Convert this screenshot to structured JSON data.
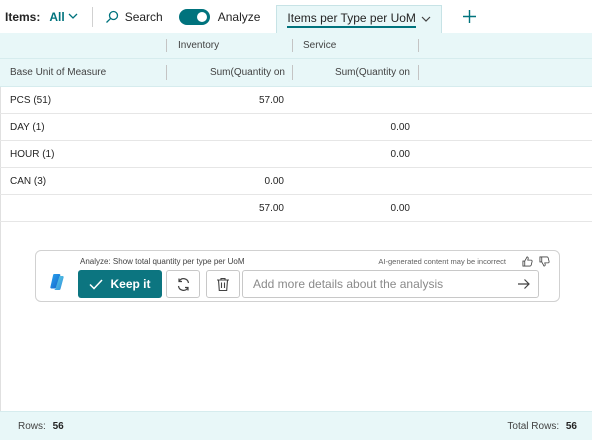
{
  "toolbar": {
    "items_label": "Items:",
    "filter_value": "All",
    "search_label": "Search",
    "analyze_label": "Analyze",
    "analyze_on": true,
    "active_tab": "Items per Type per UoM"
  },
  "grid": {
    "group_headers": [
      "Inventory",
      "Service"
    ],
    "columns": [
      "Base Unit of Measure",
      "Sum(Quantity on",
      "Sum(Quantity on"
    ],
    "rows": [
      [
        "PCS (51)",
        "57.00",
        ""
      ],
      [
        "DAY (1)",
        "",
        "0.00"
      ],
      [
        "HOUR (1)",
        "",
        "0.00"
      ],
      [
        "CAN (3)",
        "0.00",
        ""
      ]
    ],
    "totals": [
      "",
      "57.00",
      "0.00"
    ]
  },
  "copilot": {
    "title": "Analyze: Show total quantity per type per UoM",
    "disclaimer": "AI-generated content may be incorrect",
    "keep_label": "Keep it",
    "input_placeholder": "Add more details about the analysis"
  },
  "footer": {
    "rows_label": "Rows:",
    "rows_value": "56",
    "total_rows_label": "Total Rows:",
    "total_rows_value": "56"
  },
  "colors": {
    "accent": "#00737d",
    "header_bg": "#e8f7f8",
    "button": "#0c7580"
  },
  "icons": [
    "chevron-down-icon",
    "search-icon",
    "plus-icon",
    "copilot-icon",
    "checkmark-icon",
    "regenerate-icon",
    "trash-icon",
    "send-arrow-icon",
    "thumbs-up-icon",
    "thumbs-down-icon"
  ]
}
